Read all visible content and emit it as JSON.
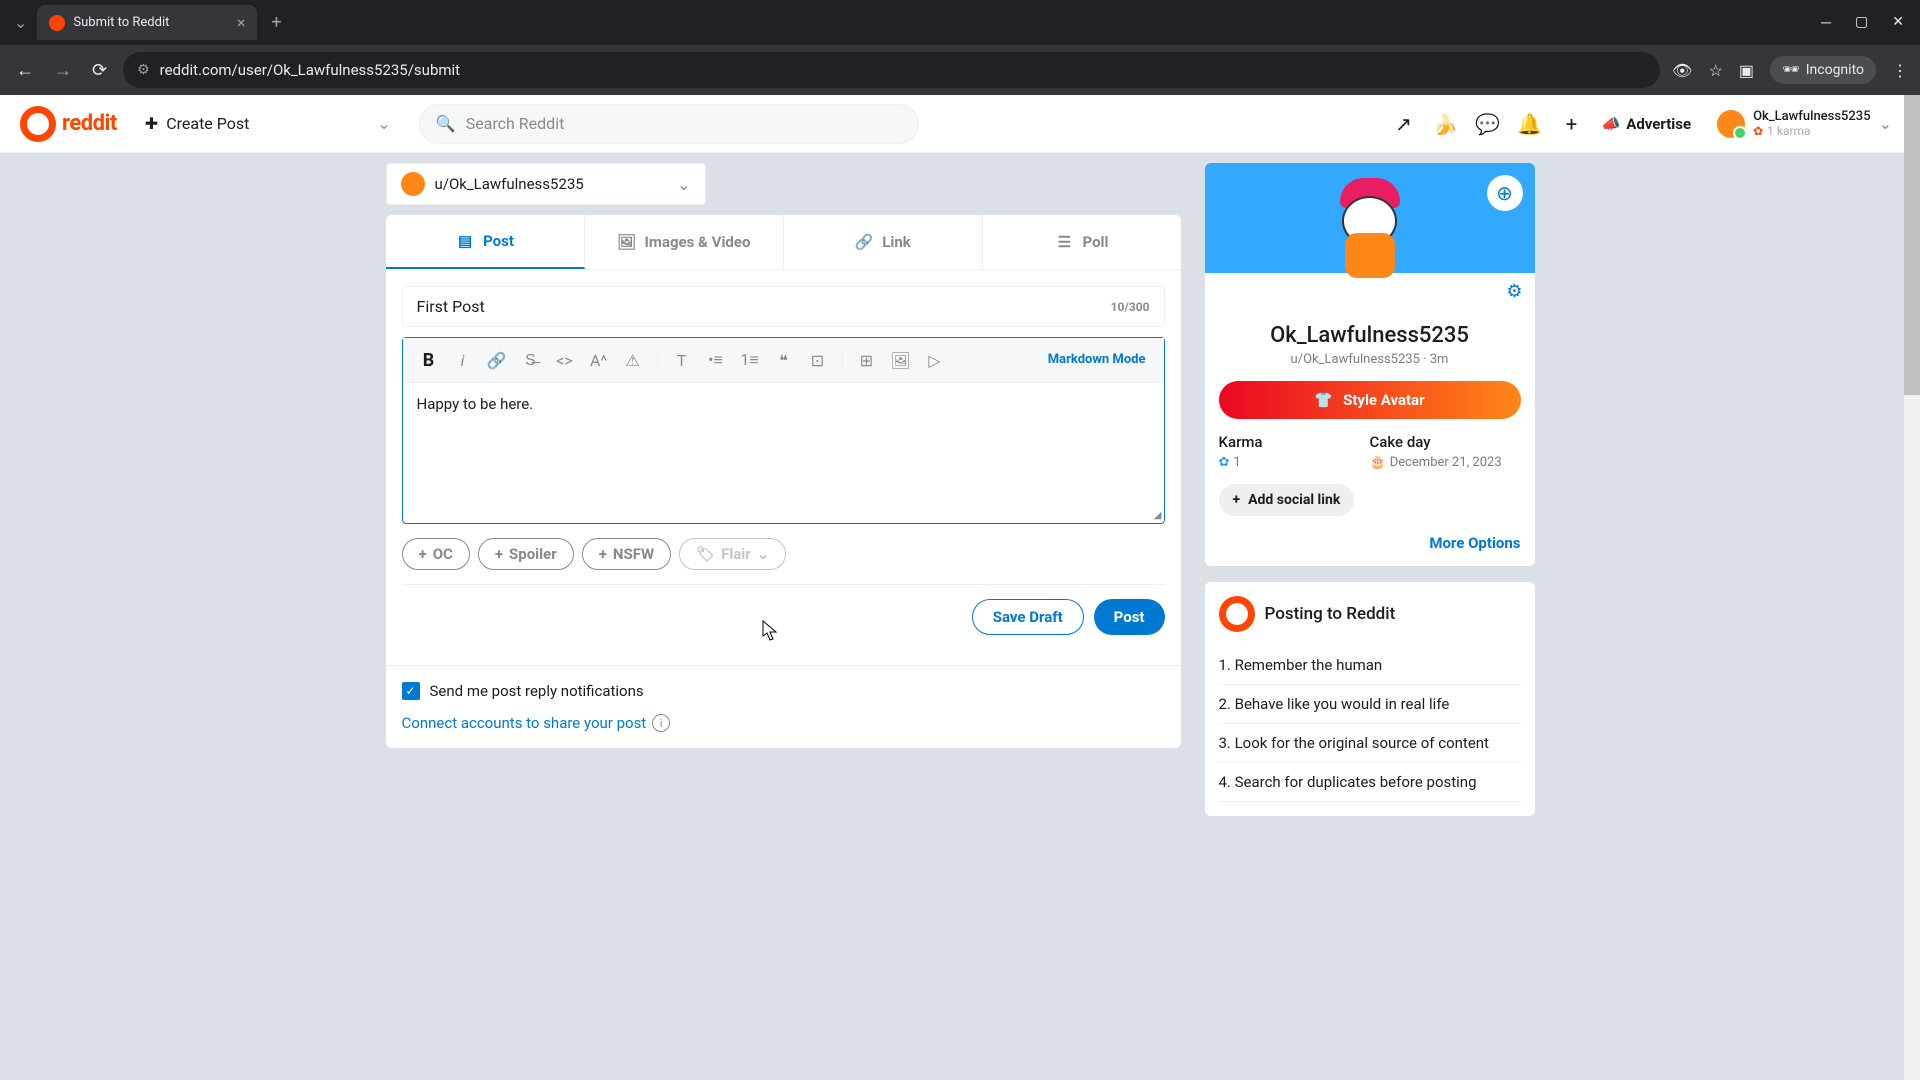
{
  "browser": {
    "tab_title": "Submit to Reddit",
    "url": "reddit.com/user/Ok_Lawfulness5235/submit",
    "incognito": "Incognito"
  },
  "header": {
    "logo_text": "reddit",
    "create_post": "Create Post",
    "search_placeholder": "Search Reddit",
    "advertise": "Advertise",
    "user_name": "Ok_Lawfulness5235",
    "user_karma": "1 karma"
  },
  "community": {
    "name": "u/Ok_Lawfulness5235"
  },
  "tabs": {
    "post": "Post",
    "images": "Images & Video",
    "link": "Link",
    "poll": "Poll"
  },
  "form": {
    "title_value": "First Post",
    "char_count": "10/300",
    "body_text": "Happy to be here.",
    "markdown_toggle": "Markdown Mode",
    "tags": {
      "oc": "OC",
      "spoiler": "Spoiler",
      "nsfw": "NSFW",
      "flair": "Flair"
    },
    "save_draft": "Save Draft",
    "post": "Post",
    "notify_label": "Send me post reply notifications",
    "connect_link": "Connect accounts to share your post"
  },
  "profile": {
    "display_name": "Ok_Lawfulness5235",
    "handle": "u/Ok_Lawfulness5235 · 3m",
    "style_avatar": "Style Avatar",
    "karma_label": "Karma",
    "karma_value": "1",
    "cake_label": "Cake day",
    "cake_value": "December 21, 2023",
    "add_social": "Add social link",
    "more_options": "More Options"
  },
  "rules": {
    "title": "Posting to Reddit",
    "items": [
      "1. Remember the human",
      "2. Behave like you would in real life",
      "3. Look for the original source of content",
      "4. Search for duplicates before posting"
    ]
  }
}
